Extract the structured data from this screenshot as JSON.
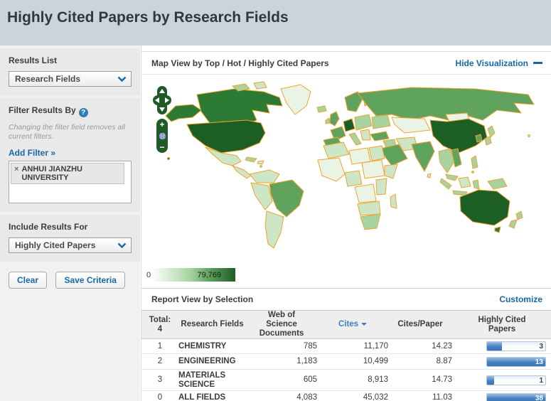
{
  "header": {
    "title": "Highly Cited Papers by Research Fields"
  },
  "sidebar": {
    "results_list": {
      "label": "Results List",
      "selected": "Research Fields"
    },
    "filter": {
      "label": "Filter Results By",
      "help_glyph": "?",
      "note": "Changing the filter field removes all current filters.",
      "add_filter_label": "Add Filter »",
      "chips": [
        {
          "remove_glyph": "×",
          "label": "ANHUI JIANZHU UNIVERSITY"
        }
      ]
    },
    "include": {
      "label": "Include Results For",
      "selected": "Highly Cited Papers"
    },
    "buttons": {
      "clear": "Clear",
      "save": "Save Criteria"
    }
  },
  "viz": {
    "title": "Map View by Top / Hot / Highly Cited Papers",
    "hide_label": "Hide Visualization",
    "controls": {
      "zoom_in": "+",
      "zoom_out": "−"
    },
    "legend": {
      "min": "0",
      "max": "79,769"
    }
  },
  "report": {
    "title": "Report View by Selection",
    "customize_label": "Customize",
    "table": {
      "total_label": "Total:",
      "total_value": "4",
      "headers": {
        "fields": "Research Fields",
        "docs": "Web of Science Documents",
        "cites": "Cites",
        "cpp": "Cites/Paper",
        "hcp": "Highly Cited Papers"
      },
      "rows": [
        {
          "rank": "1",
          "field": "CHEMISTRY",
          "docs": "785",
          "cites": "11,170",
          "cpp": "14.23",
          "hcp": "3",
          "bar_pct": 26
        },
        {
          "rank": "2",
          "field": "ENGINEERING",
          "docs": "1,183",
          "cites": "10,499",
          "cpp": "8.87",
          "hcp": "13",
          "bar_pct": 100
        },
        {
          "rank": "3",
          "field": "MATERIALS SCIENCE",
          "docs": "605",
          "cites": "8,913",
          "cpp": "14.73",
          "hcp": "1",
          "bar_pct": 12
        },
        {
          "rank": "0",
          "field": "ALL FIELDS",
          "docs": "4,083",
          "cites": "45,032",
          "cpp": "11.03",
          "hcp": "38",
          "bar_pct": 100
        }
      ]
    }
  },
  "colors": {
    "css_vars": {
      "header-band": "#ccd4db",
      "accent": "#1569a8",
      "field-link": "#0e6d9e",
      "help-blue": "#2e7fb7",
      "ctl-green": "#1e5b26",
      "map-border": "#efa42d",
      "bar-blue": "#447fc1",
      "bar-border": "#b3c6da",
      "thead-bg": "#eeeeee",
      "m0": "#e9f4e4",
      "m1": "#cce6c6",
      "m2": "#a6d3a0",
      "m3": "#5fa35f",
      "m4": "#2c7a34",
      "m5": "#1c5e24"
    }
  }
}
